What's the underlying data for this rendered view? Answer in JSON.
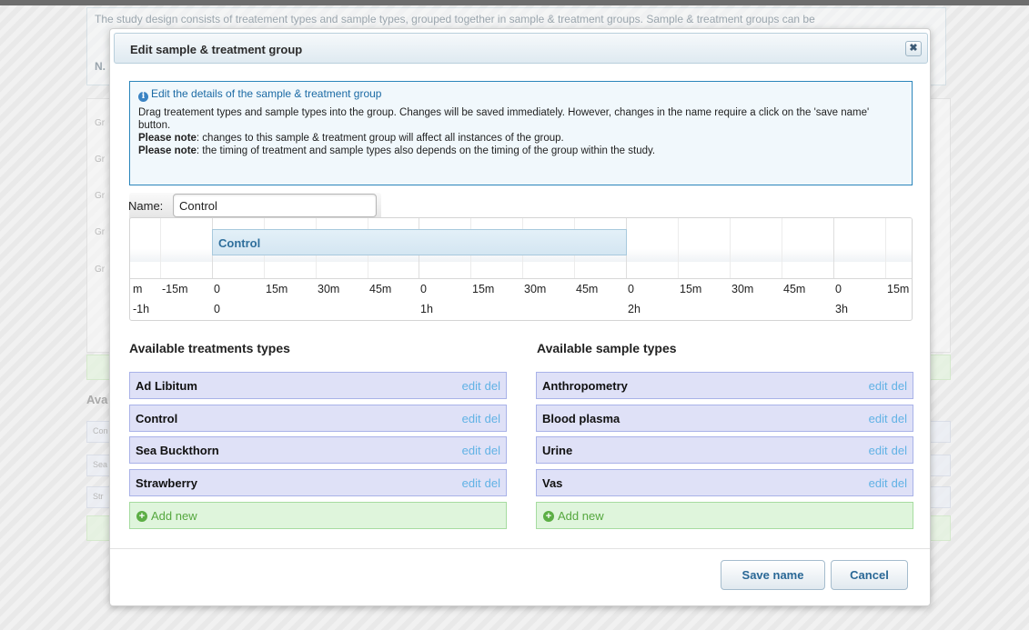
{
  "background": {
    "intro_text": "The study design consists of treatement types and sample types, grouped together in sample & treatment groups. Sample & treatment groups can be",
    "intro_label": "N.",
    "rows": [
      "Gr",
      "Gr",
      "Gr",
      "Gr",
      "Gr"
    ],
    "available_label": "Ava",
    "items": [
      "Con",
      "Sea",
      "Str"
    ]
  },
  "modal": {
    "title": "Edit sample & treatment group",
    "close_symbol": "✖",
    "info": {
      "icon": "i",
      "title": "Edit the details of the sample & treatment group",
      "line1": "Drag treatement types and sample types into the group. Changes will be saved immediately. However, changes in the name require a click on the 'save name' button.",
      "note_label": "Please note",
      "note1": ": changes to this sample & treatment group will affect all instances of the group.",
      "note2": ": the timing of treatment and sample types also depends on the timing of the group within the study."
    },
    "name_label": "Name:",
    "name_value": "Control",
    "timeline": {
      "group_label": "Control",
      "minute_labels": [
        "m",
        "-15m",
        "0",
        "15m",
        "30m",
        "45m",
        "0",
        "15m",
        "30m",
        "45m",
        "0",
        "15m",
        "30m",
        "45m",
        "0",
        "15m"
      ],
      "hour_labels": [
        "-1h",
        "0",
        "1h",
        "2h",
        "3h"
      ]
    },
    "treatments": {
      "title": "Available treatments types",
      "items": [
        "Ad Libitum",
        "Control",
        "Sea Buckthorn",
        "Strawberry"
      ],
      "edit_label": "edit",
      "del_label": "del",
      "add_label": "Add new"
    },
    "samples": {
      "title": "Available sample types",
      "items": [
        "Anthropometry",
        "Blood plasma",
        "Urine",
        "Vas"
      ],
      "edit_label": "edit",
      "del_label": "del",
      "add_label": "Add new"
    },
    "buttons": {
      "save": "Save name",
      "cancel": "Cancel"
    }
  }
}
